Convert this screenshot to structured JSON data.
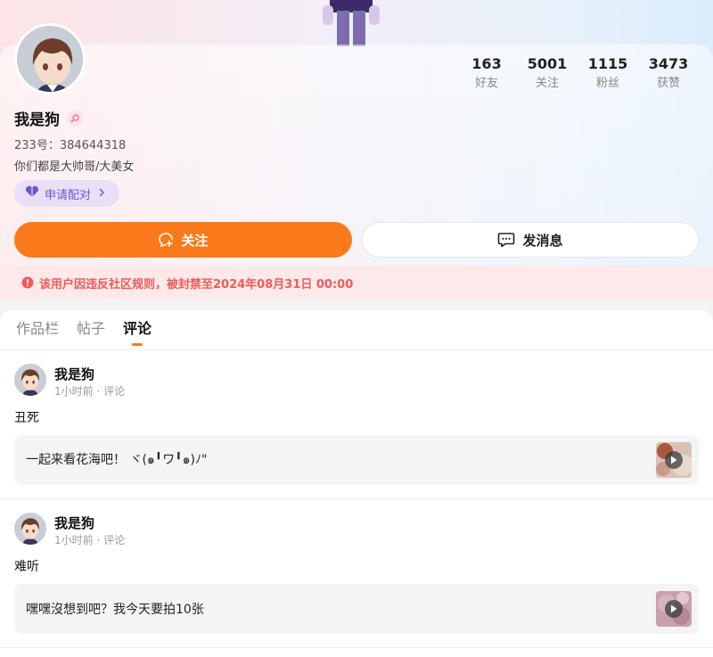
{
  "profile": {
    "username": "我是狗",
    "uid_text": "233号：384644318",
    "bio": "你们都是大帅哥/大美女",
    "pair_label": "申请配对",
    "stats": [
      {
        "value": "163",
        "label": "好友"
      },
      {
        "value": "5001",
        "label": "关注"
      },
      {
        "value": "1115",
        "label": "粉丝"
      },
      {
        "value": "3473",
        "label": "获赞"
      }
    ]
  },
  "actions": {
    "follow_label": "关注",
    "message_label": "发消息"
  },
  "ban_notice": "该用户因违反社区规则，被封禁至2024年08月31日 00:00",
  "tabs": [
    {
      "label": "作品栏",
      "active": false
    },
    {
      "label": "帖子",
      "active": false
    },
    {
      "label": "评论",
      "active": true
    }
  ],
  "posts": [
    {
      "author": "我是狗",
      "meta": "1小时前 · 评论",
      "text": "丑死",
      "quote": "一起来看花海吧！ ヾ(๑╹ワ╹๑)ﾉ\""
    },
    {
      "author": "我是狗",
      "meta": "1小时前 · 评论",
      "text": "难听",
      "quote": "嘿嘿沒想到吧？我今天要拍10张"
    }
  ],
  "colors": {
    "accent_orange": "#fb7a1c",
    "ban_text": "#ee5a5a",
    "pair_purple": "#6f57c6"
  },
  "icons": {
    "gender": "female-symbol-icon",
    "pair": "heart-icon",
    "follow": "add-heart-chat-icon",
    "message": "chat-bubble-icon",
    "ban": "warning-circle-icon",
    "play": "play-icon"
  }
}
